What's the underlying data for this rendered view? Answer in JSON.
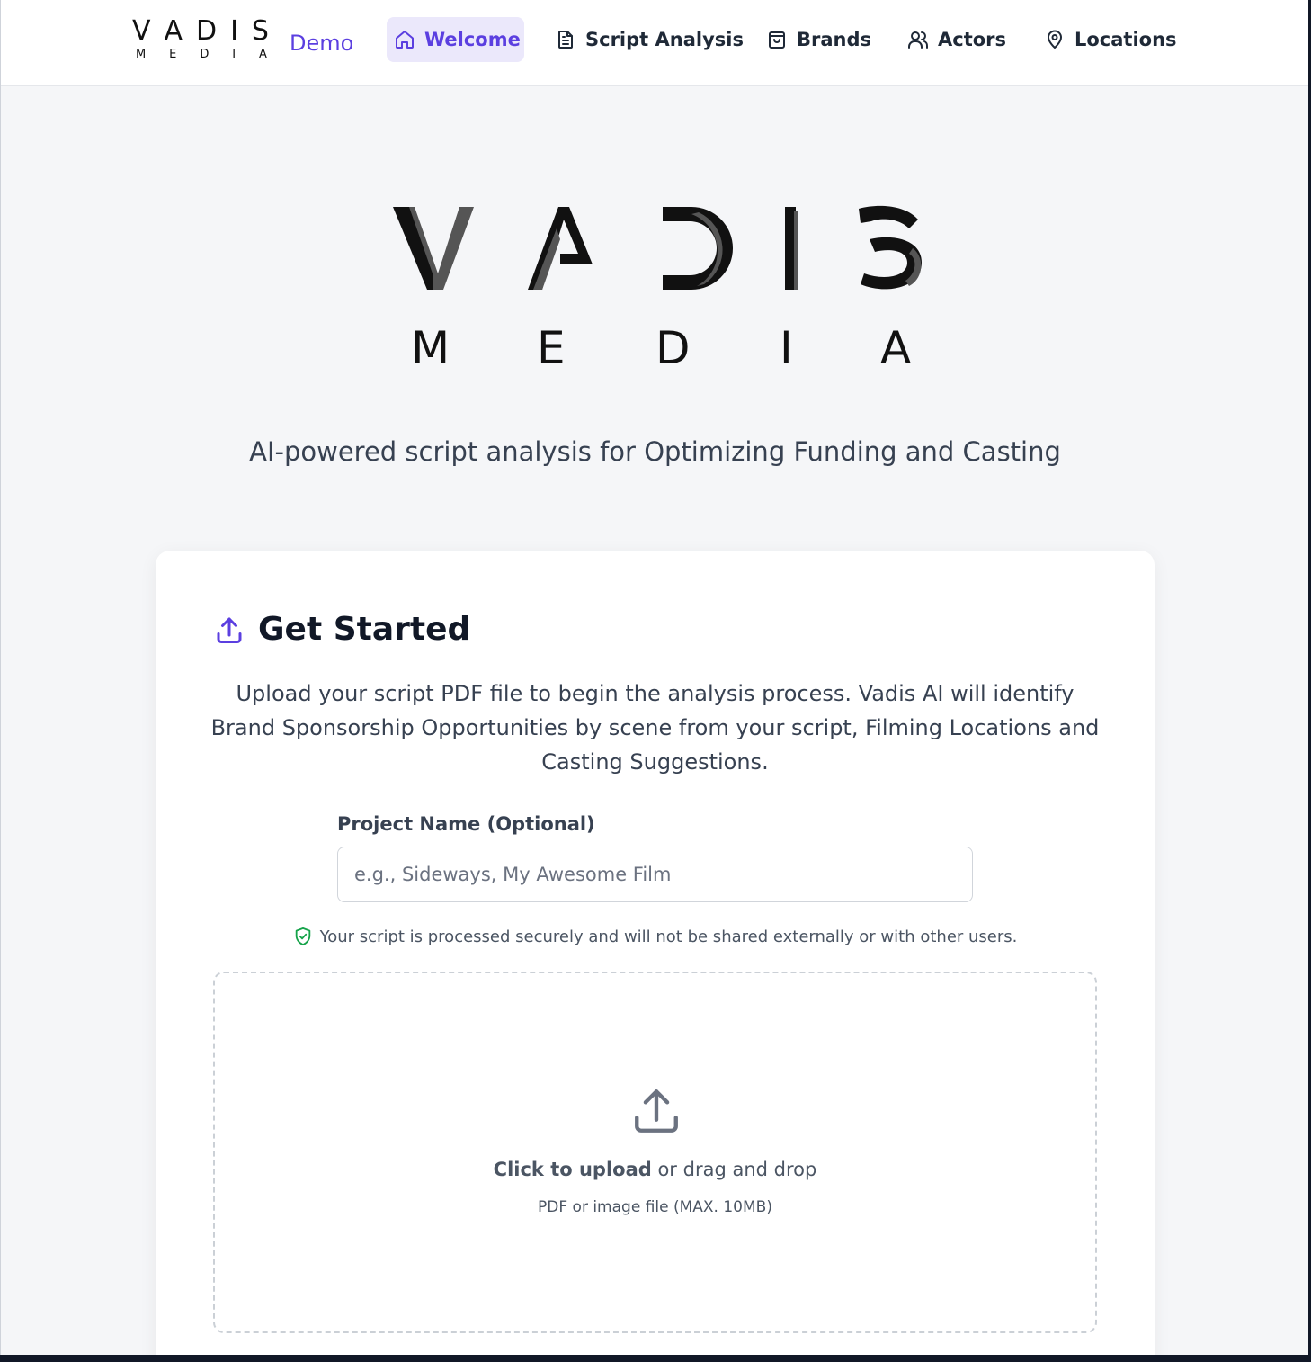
{
  "header": {
    "brand_main": [
      "V",
      "A",
      "D",
      "I",
      "S"
    ],
    "brand_sub": [
      "M",
      "E",
      "D",
      "I",
      "A"
    ],
    "demo_label": "Demo",
    "nav": {
      "welcome": "Welcome",
      "script_analysis": "Script Analysis",
      "brands": "Brands",
      "actors": "Actors",
      "locations": "Locations"
    },
    "active_tab": "Welcome"
  },
  "hero": {
    "logo_main": [
      "V",
      "A",
      "D",
      "I",
      "S"
    ],
    "logo_sub": [
      "M",
      "E",
      "D",
      "I",
      "A"
    ],
    "tagline": "AI-powered script analysis for Optimizing Funding and Casting"
  },
  "card": {
    "title": "Get Started",
    "description": "Upload your script PDF file to begin the analysis process. Vadis AI will identify Brand Sponsorship Opportunities by scene from your script, Filming Locations and Casting Suggestions.",
    "project_label": "Project Name (Optional)",
    "project_placeholder": "e.g., Sideways, My Awesome Film",
    "project_value": "",
    "secure_note": "Your script is processed securely and will not be shared externally or with other users.",
    "upload_strong": "Click to upload",
    "upload_rest": " or drag and drop",
    "upload_sub": "PDF or image file (MAX. 10MB)"
  },
  "colors": {
    "accent": "#5b3fe0",
    "accent_bg": "#ebe8fb",
    "page_bg": "#f5f6f8",
    "secure_green": "#16a34a"
  },
  "icons": {
    "welcome": "home-icon",
    "script_analysis": "document-icon",
    "brands": "shopping-bag-icon",
    "actors": "users-icon",
    "locations": "map-pin-icon",
    "get_started": "upload-icon",
    "secure": "shield-check-icon",
    "dropzone": "upload-icon"
  }
}
